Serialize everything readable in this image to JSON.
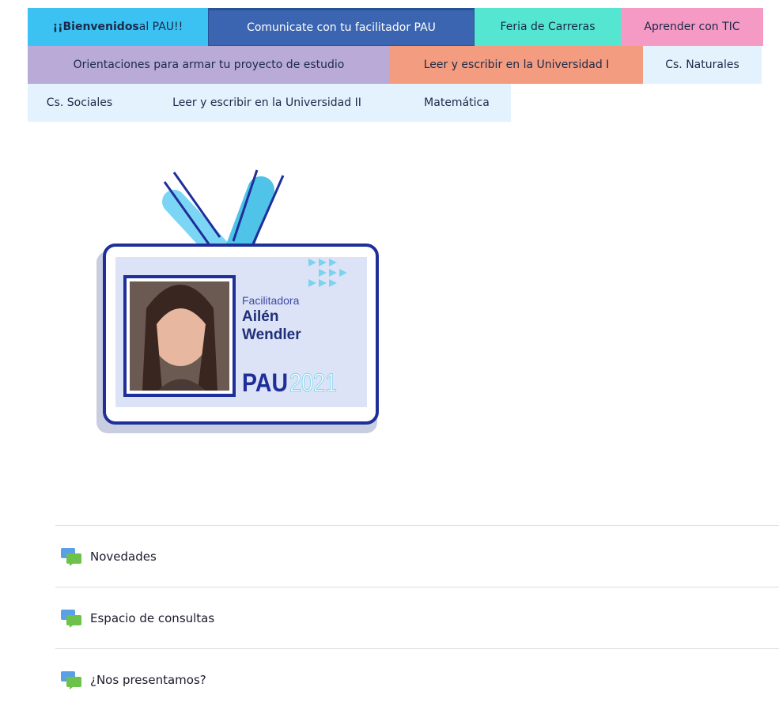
{
  "tabs": {
    "row1": [
      {
        "label_bold": "¡¡Bienvenidos",
        "label_rest": " al PAU!!",
        "color": "#3cc1f3",
        "width": 228
      },
      {
        "label": "Comunicate con tu facilitador PAU",
        "color": "#3b65b0",
        "width": 337,
        "active": true
      },
      {
        "label": "Feria de Carreras",
        "color": "#55e6d2",
        "width": 185
      },
      {
        "label": "Aprender con TIC",
        "color": "#f59ac4",
        "width": 180
      }
    ],
    "row2": [
      {
        "label": "Orientaciones para armar tu proyecto de estudio",
        "color": "#b9aad8",
        "width": 458
      },
      {
        "label": "Leer y escribir en la Universidad I",
        "color": "#f39c7f",
        "width": 320
      },
      {
        "label": "Cs. Naturales",
        "color": "#e4f2fd",
        "width": 150
      }
    ],
    "row3": [
      {
        "label": "Cs. Sociales",
        "color": "#e4f2fd",
        "width": 131
      },
      {
        "label": "Leer y escribir en la Universidad II",
        "color": "#e4f2fd",
        "width": 343
      },
      {
        "label": "Matemática",
        "color": "#e4f2fd",
        "width": 137
      }
    ]
  },
  "badge": {
    "role": "Facilitadora",
    "first_name": "Ailén",
    "last_name": "Wendler",
    "program": "PAU",
    "year": "2021"
  },
  "activities": [
    {
      "label": "Novedades",
      "icon": "forum-icon"
    },
    {
      "label": "Espacio de consultas",
      "icon": "forum-icon"
    },
    {
      "label": "¿Nos presentamos?",
      "icon": "forum-icon"
    }
  ]
}
